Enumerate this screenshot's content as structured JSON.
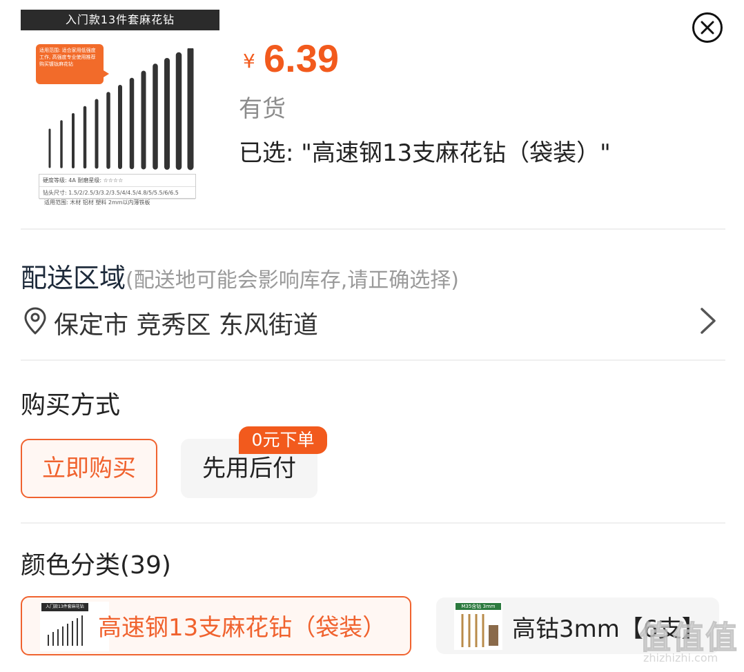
{
  "product": {
    "image": {
      "banner": "入门款13件套麻花钻",
      "note": "适用范围: 适合家用低强度工作, 高强度专业使用推荐 购买镀钛麻花钻",
      "table_row1": "硬度等级: 4A    耐磨星级: ☆☆☆☆",
      "table_row2": "钻头尺寸: 1.5/2/2.5/3/3.2/3.5/4/4.5/4.8/5/5.5/6/6.5",
      "use_line": "适用范围:   木材  铝材  塑料  2mm以内薄铁板"
    },
    "price_symbol": "¥",
    "price": "6.39",
    "stock_status": "有货",
    "selected_text": "已选: \"高速钢13支麻花钻（袋装）\""
  },
  "delivery": {
    "title": "配送区域",
    "note": "(配送地可能会影响库存,请正确选择)",
    "address": "保定市 竞秀区 东风街道"
  },
  "purchase": {
    "title": "购买方式",
    "options": [
      {
        "label": "立即购买",
        "selected": true
      },
      {
        "label": "先用后付",
        "selected": false
      }
    ],
    "badge": "0元下单"
  },
  "variants": {
    "title": "颜色分类(39)",
    "items": [
      {
        "label": "高速钢13支麻花钻（袋装）",
        "thumb_text": "入门款13件套麻花钻",
        "selected": true
      },
      {
        "label": "高钴3mm【6支】",
        "thumb_text": "M35含钴  3mm",
        "selected": false
      }
    ]
  },
  "watermark": {
    "text": "值值值",
    "url": "zhizhizhi.com"
  },
  "colors": {
    "accent": "#f25a1d",
    "divider": "#efefef",
    "muted": "#8c8c8c"
  },
  "icons": {
    "close": "close-icon",
    "location": "location-pin-icon",
    "chevron": "chevron-right-icon"
  }
}
